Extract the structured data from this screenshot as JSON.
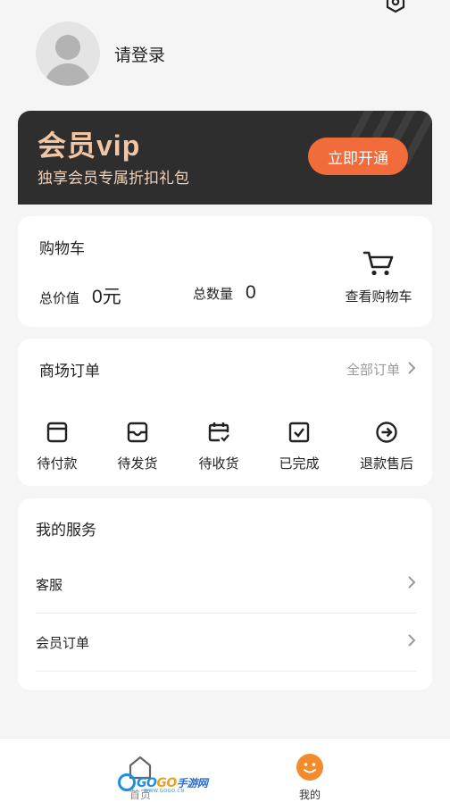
{
  "profile": {
    "login_text": "请登录"
  },
  "vip": {
    "title": "会员vip",
    "subtitle": "独享会员专属折扣礼包",
    "button": "立即开通"
  },
  "cart": {
    "title": "购物车",
    "total_price_label": "总价值",
    "total_price_value": "0元",
    "total_count_label": "总数量",
    "total_count_value": "0",
    "view_cart_label": "查看购物车"
  },
  "orders": {
    "title": "商场订单",
    "all_label": "全部订单",
    "items": [
      {
        "label": "待付款",
        "icon": "wallet-icon"
      },
      {
        "label": "待发货",
        "icon": "inbox-icon"
      },
      {
        "label": "待收货",
        "icon": "calendar-check-icon"
      },
      {
        "label": "已完成",
        "icon": "checkbox-icon"
      },
      {
        "label": "退款售后",
        "icon": "arrow-circle-icon"
      }
    ]
  },
  "services": {
    "title": "我的服务",
    "items": [
      {
        "label": "客服"
      },
      {
        "label": "会员订单"
      }
    ]
  },
  "tabbar": {
    "home_label": "首页",
    "mine_label": "我的"
  },
  "watermark": {
    "text_a": "GO",
    "text_b": "GO",
    "text_c": "手游网",
    "small": "WWW.GOGO.CN"
  },
  "colors": {
    "accent": "#f26b3a",
    "vip_bg": "#2e2e2e",
    "vip_title": "#f2c6a4",
    "background": "#f5f5f5",
    "muted_text": "#9a9a9a"
  }
}
